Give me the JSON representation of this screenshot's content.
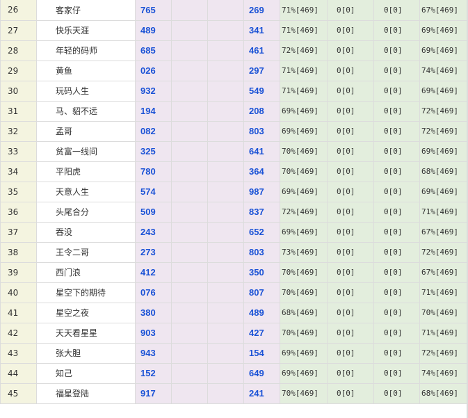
{
  "rows": [
    {
      "rank": "26",
      "name": "客家仔",
      "n1": "765",
      "n2": "",
      "n3": "",
      "n4": "269",
      "p1": "71%[469]",
      "p2": "0[0]",
      "p3": "0[0]",
      "p4": "67%[469]"
    },
    {
      "rank": "27",
      "name": "快乐天涯",
      "n1": "489",
      "n2": "",
      "n3": "",
      "n4": "341",
      "p1": "71%[469]",
      "p2": "0[0]",
      "p3": "0[0]",
      "p4": "69%[469]"
    },
    {
      "rank": "28",
      "name": "年轻的码师",
      "n1": "685",
      "n2": "",
      "n3": "",
      "n4": "461",
      "p1": "72%[469]",
      "p2": "0[0]",
      "p3": "0[0]",
      "p4": "69%[469]"
    },
    {
      "rank": "29",
      "name": "黄鱼",
      "n1": "026",
      "n2": "",
      "n3": "",
      "n4": "297",
      "p1": "71%[469]",
      "p2": "0[0]",
      "p3": "0[0]",
      "p4": "74%[469]"
    },
    {
      "rank": "30",
      "name": "玩码人生",
      "n1": "932",
      "n2": "",
      "n3": "",
      "n4": "549",
      "p1": "71%[469]",
      "p2": "0[0]",
      "p3": "0[0]",
      "p4": "69%[469]"
    },
    {
      "rank": "31",
      "name": "马、貂不远",
      "n1": "194",
      "n2": "",
      "n3": "",
      "n4": "208",
      "p1": "69%[469]",
      "p2": "0[0]",
      "p3": "0[0]",
      "p4": "72%[469]"
    },
    {
      "rank": "32",
      "name": "孟哥",
      "n1": "082",
      "n2": "",
      "n3": "",
      "n4": "803",
      "p1": "69%[469]",
      "p2": "0[0]",
      "p3": "0[0]",
      "p4": "72%[469]"
    },
    {
      "rank": "33",
      "name": "贫富一线间",
      "n1": "325",
      "n2": "",
      "n3": "",
      "n4": "641",
      "p1": "70%[469]",
      "p2": "0[0]",
      "p3": "0[0]",
      "p4": "69%[469]"
    },
    {
      "rank": "34",
      "name": "平阳虎",
      "n1": "780",
      "n2": "",
      "n3": "",
      "n4": "364",
      "p1": "70%[469]",
      "p2": "0[0]",
      "p3": "0[0]",
      "p4": "68%[469]"
    },
    {
      "rank": "35",
      "name": "天意人生",
      "n1": "574",
      "n2": "",
      "n3": "",
      "n4": "987",
      "p1": "69%[469]",
      "p2": "0[0]",
      "p3": "0[0]",
      "p4": "69%[469]"
    },
    {
      "rank": "36",
      "name": "头尾合分",
      "n1": "509",
      "n2": "",
      "n3": "",
      "n4": "837",
      "p1": "72%[469]",
      "p2": "0[0]",
      "p3": "0[0]",
      "p4": "71%[469]"
    },
    {
      "rank": "37",
      "name": "吞没",
      "n1": "243",
      "n2": "",
      "n3": "",
      "n4": "652",
      "p1": "69%[469]",
      "p2": "0[0]",
      "p3": "0[0]",
      "p4": "67%[469]"
    },
    {
      "rank": "38",
      "name": "王令二哥",
      "n1": "273",
      "n2": "",
      "n3": "",
      "n4": "803",
      "p1": "73%[469]",
      "p2": "0[0]",
      "p3": "0[0]",
      "p4": "72%[469]"
    },
    {
      "rank": "39",
      "name": "西门浪",
      "n1": "412",
      "n2": "",
      "n3": "",
      "n4": "350",
      "p1": "70%[469]",
      "p2": "0[0]",
      "p3": "0[0]",
      "p4": "67%[469]"
    },
    {
      "rank": "40",
      "name": "星空下的期待",
      "n1": "076",
      "n2": "",
      "n3": "",
      "n4": "807",
      "p1": "70%[469]",
      "p2": "0[0]",
      "p3": "0[0]",
      "p4": "71%[469]"
    },
    {
      "rank": "41",
      "name": "星空之夜",
      "n1": "380",
      "n2": "",
      "n3": "",
      "n4": "489",
      "p1": "68%[469]",
      "p2": "0[0]",
      "p3": "0[0]",
      "p4": "70%[469]"
    },
    {
      "rank": "42",
      "name": "天天看星星",
      "n1": "903",
      "n2": "",
      "n3": "",
      "n4": "427",
      "p1": "70%[469]",
      "p2": "0[0]",
      "p3": "0[0]",
      "p4": "71%[469]"
    },
    {
      "rank": "43",
      "name": "张大胆",
      "n1": "943",
      "n2": "",
      "n3": "",
      "n4": "154",
      "p1": "69%[469]",
      "p2": "0[0]",
      "p3": "0[0]",
      "p4": "72%[469]"
    },
    {
      "rank": "44",
      "name": "知己",
      "n1": "152",
      "n2": "",
      "n3": "",
      "n4": "649",
      "p1": "69%[469]",
      "p2": "0[0]",
      "p3": "0[0]",
      "p4": "74%[469]"
    },
    {
      "rank": "45",
      "name": "福星登陆",
      "n1": "917",
      "n2": "",
      "n3": "",
      "n4": "241",
      "p1": "70%[469]",
      "p2": "0[0]",
      "p3": "0[0]",
      "p4": "68%[469]"
    }
  ],
  "colors": {
    "rank_bg": "#f4f4e0",
    "name_bg": "#ffffff",
    "number_bg": "#efe6f0",
    "number_text": "#1a52d6",
    "percent_bg": "#e3eedd",
    "border": "#dcdcdc"
  }
}
